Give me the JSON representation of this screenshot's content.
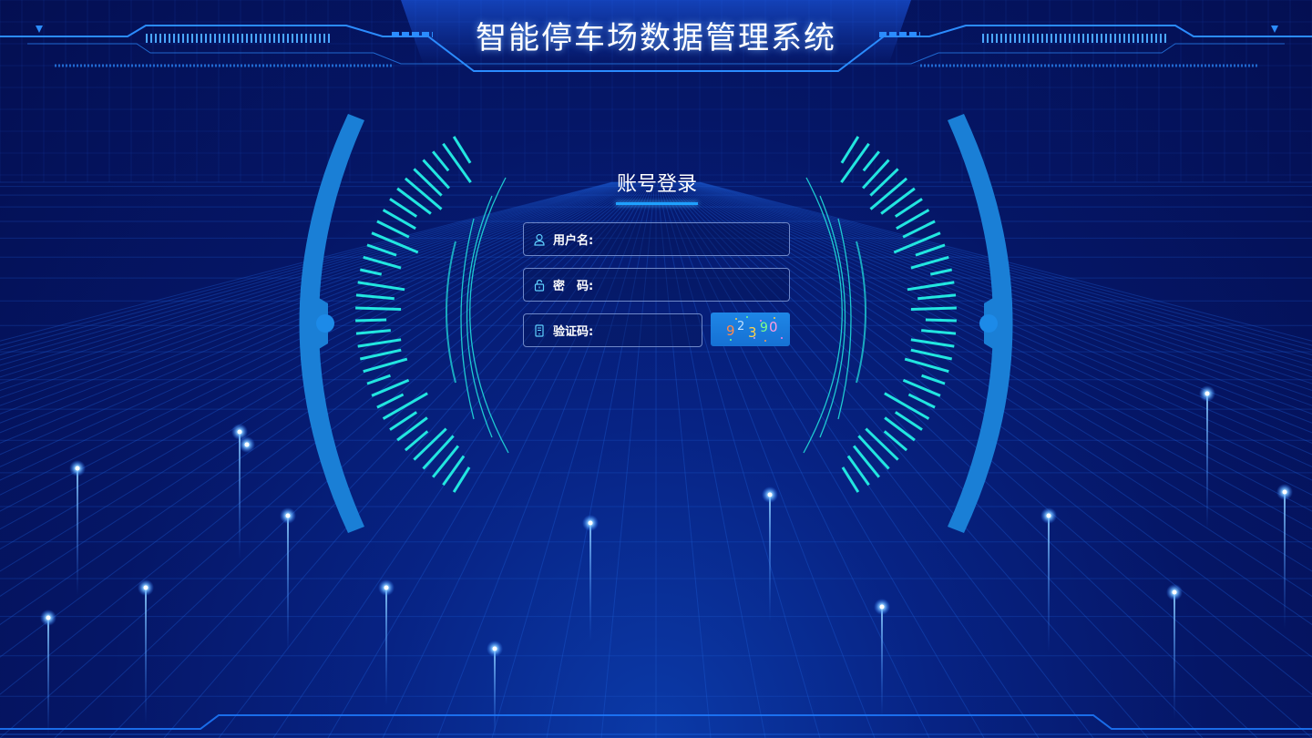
{
  "header": {
    "title": "智能停车场数据管理系统"
  },
  "login": {
    "title": "账号登录",
    "username_label": "用户名:",
    "password_label": "密　码:",
    "captcha_label": "验证码:",
    "captcha_chars": [
      "9",
      "2",
      "3",
      "9",
      "0"
    ]
  },
  "colors": {
    "background": "#041058",
    "accent": "#1ea0ff",
    "cyan": "#22e6e0",
    "arc": "#1a7fd6"
  },
  "icons": {
    "username": "user-icon",
    "password": "lock-icon",
    "captcha": "phone-icon"
  }
}
